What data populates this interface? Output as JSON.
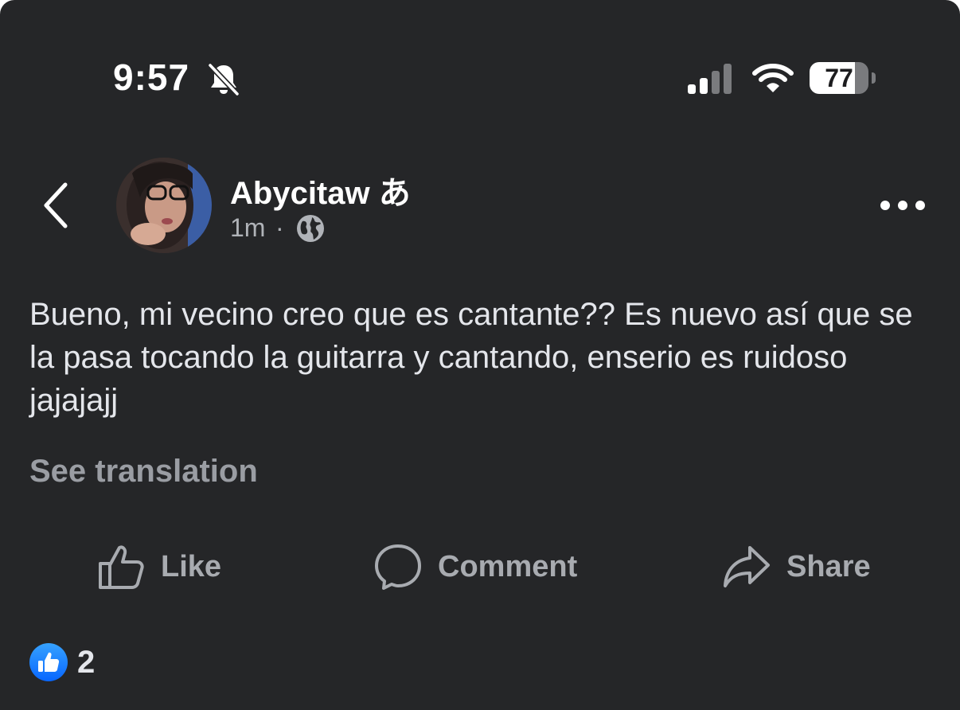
{
  "status_bar": {
    "time": "9:57",
    "battery_percent": "77",
    "bell_icon": "bell-slash-icon",
    "signal_icon": "cellular-signal-icon",
    "wifi_icon": "wifi-icon"
  },
  "header": {
    "back_icon": "chevron-left-icon",
    "author_name": "Abycitaw あ",
    "timestamp": "1m",
    "separator": "·",
    "audience_icon": "globe-icon",
    "more_icon": "ellipsis-icon"
  },
  "post": {
    "text": "Bueno, mi vecino creo que es cantante?? Es nuevo así que se la pasa tocando la guitarra y cantando, enserio es ruidoso jajajajj",
    "see_translation": "See translation"
  },
  "actions": {
    "like": "Like",
    "comment": "Comment",
    "share": "Share"
  },
  "reactions": {
    "icon": "like-reaction-icon",
    "count": "2"
  },
  "colors": {
    "background": "#252628",
    "text_primary": "#e4e6eb",
    "text_secondary": "#b0b3b8",
    "action_text": "#a8abb0",
    "like_blue": "#2e89ff"
  }
}
